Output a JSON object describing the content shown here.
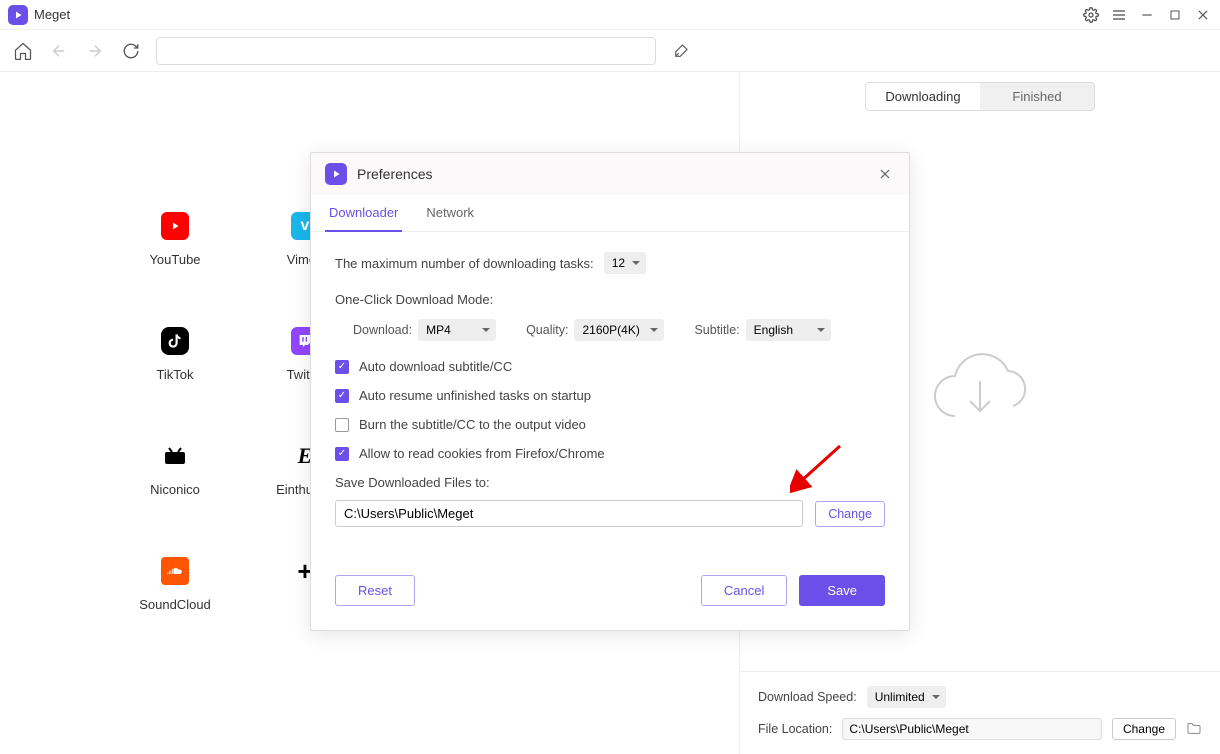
{
  "app": {
    "name": "Meget"
  },
  "tabs": {
    "downloading": "Downloading",
    "finished": "Finished"
  },
  "sites": [
    {
      "name": "YouTube"
    },
    {
      "name": "Vimeo"
    },
    {
      "name": "TikTok"
    },
    {
      "name": "Twitch"
    },
    {
      "name": "Niconico"
    },
    {
      "name": "Einthusan"
    },
    {
      "name": "SoundCloud"
    }
  ],
  "right": {
    "speed_label": "Download Speed:",
    "speed_value": "Unlimited",
    "loc_label": "File Location:",
    "loc_value": "C:\\Users\\Public\\Meget",
    "change": "Change"
  },
  "modal": {
    "title": "Preferences",
    "tab_downloader": "Downloader",
    "tab_network": "Network",
    "max_tasks_label": "The maximum number of downloading tasks:",
    "max_tasks_value": "12",
    "mode_label": "One-Click Download Mode:",
    "download_label": "Download:",
    "download_value": "MP4",
    "quality_label": "Quality:",
    "quality_value": "2160P(4K)",
    "subtitle_label": "Subtitle:",
    "subtitle_value": "English",
    "chk1": "Auto download subtitle/CC",
    "chk2": "Auto resume unfinished tasks on startup",
    "chk3": "Burn the subtitle/CC to the output video",
    "chk4": "Allow to read cookies from Firefox/Chrome",
    "save_label": "Save Downloaded Files to:",
    "save_path": "C:\\Users\\Public\\Meget",
    "change_btn": "Change",
    "reset": "Reset",
    "cancel": "Cancel",
    "save": "Save"
  }
}
